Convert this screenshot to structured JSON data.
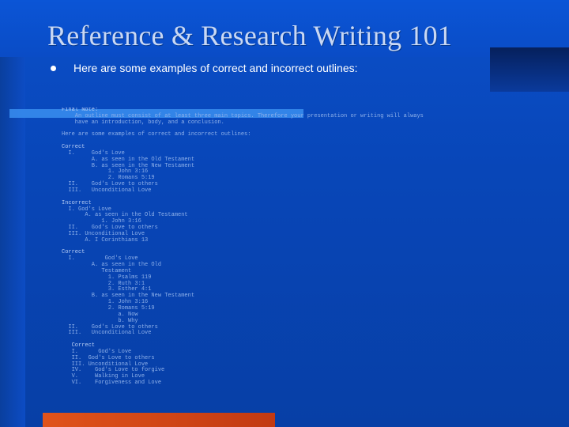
{
  "slide": {
    "title": "Reference & Research Writing 101",
    "bullet": "Here are some examples of correct and incorrect outlines:"
  },
  "outline_lines": [
    {
      "text": "Final Note:",
      "bold": true
    },
    {
      "text": "    An outline must consist of at least three main topics. Therefore your presentation or writing will always",
      "bold": false
    },
    {
      "text": "    have an introduction, body, and a conclusion.",
      "bold": false
    },
    {
      "text": "",
      "bold": false
    },
    {
      "text": "Here are some examples of correct and incorrect outlines:",
      "bold": false
    },
    {
      "text": "",
      "bold": false
    },
    {
      "text": "Correct",
      "bold": true
    },
    {
      "text": "  I.     God's Love",
      "bold": false
    },
    {
      "text": "         A. as seen in the Old Testament",
      "bold": false
    },
    {
      "text": "         B. as seen in the New Testament",
      "bold": false
    },
    {
      "text": "              1. John 3:16",
      "bold": false
    },
    {
      "text": "              2. Romans 5:19",
      "bold": false
    },
    {
      "text": "  II.    God's Love to others",
      "bold": false
    },
    {
      "text": "  III.   Unconditional Love",
      "bold": false
    },
    {
      "text": "",
      "bold": false
    },
    {
      "text": "Incorrect",
      "bold": true
    },
    {
      "text": "  I. God's Love",
      "bold": false
    },
    {
      "text": "       A. as seen in the Old Testament",
      "bold": false
    },
    {
      "text": "            1. John 3:16",
      "bold": false
    },
    {
      "text": "  II.    God's Love to others",
      "bold": false
    },
    {
      "text": "  III. Unconditional Love",
      "bold": false
    },
    {
      "text": "       A. I Corinthians 13",
      "bold": false
    },
    {
      "text": "",
      "bold": false
    },
    {
      "text": "Correct",
      "bold": true
    },
    {
      "text": "  I.         God's Love",
      "bold": false
    },
    {
      "text": "         A. as seen in the Old",
      "bold": false
    },
    {
      "text": "            Testament",
      "bold": false
    },
    {
      "text": "              1. Psalms 119",
      "bold": false
    },
    {
      "text": "              2. Ruth 3:1",
      "bold": false
    },
    {
      "text": "              3. Esther 4:1",
      "bold": false
    },
    {
      "text": "         B. as seen in the New Testament",
      "bold": false
    },
    {
      "text": "              1. John 3:16",
      "bold": false
    },
    {
      "text": "              2. Romans 5:19",
      "bold": false
    },
    {
      "text": "                 a. Now",
      "bold": false
    },
    {
      "text": "                 b. Why",
      "bold": false
    },
    {
      "text": "  II.    God's Love to others",
      "bold": false
    },
    {
      "text": "  III.   Unconditional Love",
      "bold": false
    },
    {
      "text": "",
      "bold": false
    },
    {
      "text": "   Correct",
      "bold": true
    },
    {
      "text": "   I.      God's Love",
      "bold": false
    },
    {
      "text": "   II.  God's Love to others",
      "bold": false
    },
    {
      "text": "   III. Unconditional Love",
      "bold": false
    },
    {
      "text": "   IV.    God's Love to forgive",
      "bold": false
    },
    {
      "text": "   V.     Walking in Love",
      "bold": false
    },
    {
      "text": "   VI.    Forgiveness and Love",
      "bold": false
    }
  ],
  "colors": {
    "background": "#0846b8",
    "title": "#c9d8f4",
    "accent_bar": "#e0531a",
    "highlight": "#3a8ef0"
  }
}
